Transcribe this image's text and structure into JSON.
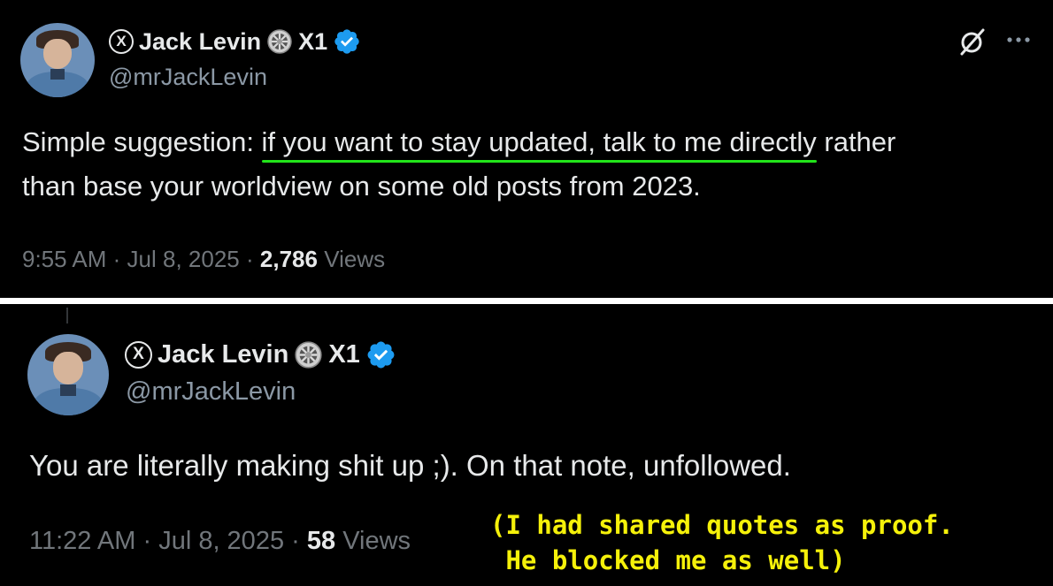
{
  "post1": {
    "author": "Jack Levin",
    "affiliate_label": "X1",
    "handle": "@mrJackLevin",
    "text_before": "Simple suggestion: ",
    "text_highlight": "if you want to stay updated, talk to me directly",
    "text_after_line1": " rather",
    "text_line2": "than base your worldview on some old posts from 2023.",
    "time": "9:55 AM",
    "sep": "·",
    "date": "Jul 8, 2025",
    "views_count": "2,786",
    "views_label": "Views",
    "highlight_color": "#22e41a",
    "more_icon": "more-dots-icon",
    "grok_icon": "grok-slash-icon"
  },
  "post2": {
    "author": "Jack Levin",
    "affiliate_label": "X1",
    "handle": "@mrJackLevin",
    "text": "You are literally making shit up ;).  On that note, unfollowed.",
    "time": "11:22 AM",
    "sep": "·",
    "date": "Jul 8, 2025",
    "views_count": "58",
    "views_label": "Views"
  },
  "annotation": {
    "line1": "(I had shared quotes as proof.",
    "line2": " He blocked me as well)",
    "color": "#f5f10a"
  },
  "colors": {
    "background": "#000000",
    "text": "#e7e9ea",
    "muted": "#71767b",
    "verified": "#1d9bf0",
    "divider": "#ffffff"
  }
}
